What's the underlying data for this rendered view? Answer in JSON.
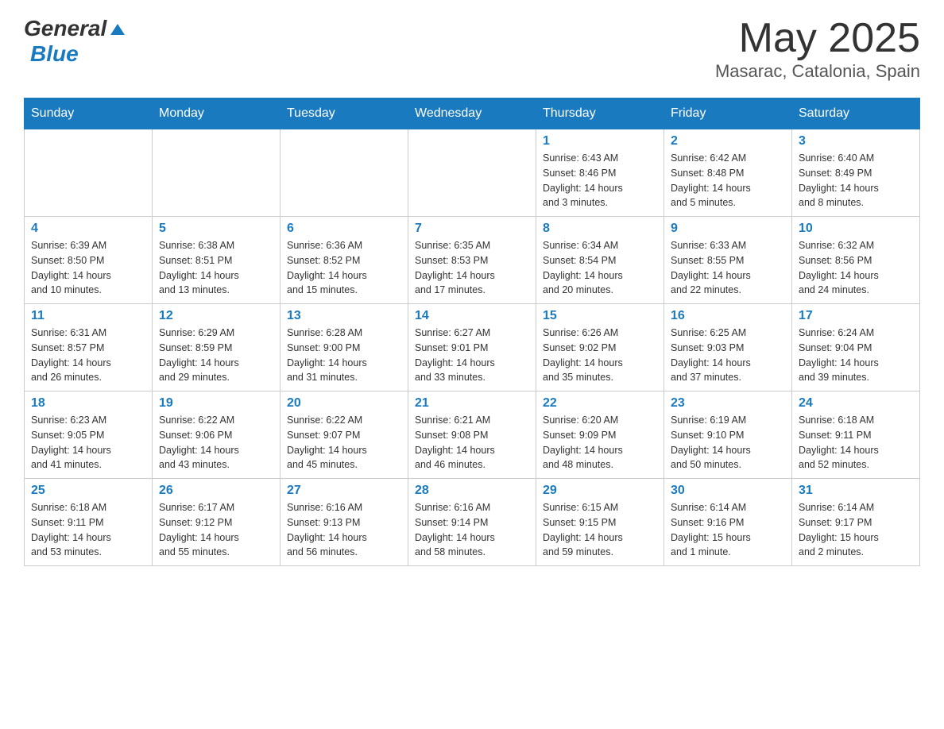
{
  "header": {
    "logo_text_general": "General",
    "logo_text_blue": "Blue",
    "month": "May 2025",
    "location": "Masarac, Catalonia, Spain"
  },
  "days_of_week": [
    "Sunday",
    "Monday",
    "Tuesday",
    "Wednesday",
    "Thursday",
    "Friday",
    "Saturday"
  ],
  "weeks": [
    [
      {
        "day": "",
        "info": ""
      },
      {
        "day": "",
        "info": ""
      },
      {
        "day": "",
        "info": ""
      },
      {
        "day": "",
        "info": ""
      },
      {
        "day": "1",
        "info": "Sunrise: 6:43 AM\nSunset: 8:46 PM\nDaylight: 14 hours\nand 3 minutes."
      },
      {
        "day": "2",
        "info": "Sunrise: 6:42 AM\nSunset: 8:48 PM\nDaylight: 14 hours\nand 5 minutes."
      },
      {
        "day": "3",
        "info": "Sunrise: 6:40 AM\nSunset: 8:49 PM\nDaylight: 14 hours\nand 8 minutes."
      }
    ],
    [
      {
        "day": "4",
        "info": "Sunrise: 6:39 AM\nSunset: 8:50 PM\nDaylight: 14 hours\nand 10 minutes."
      },
      {
        "day": "5",
        "info": "Sunrise: 6:38 AM\nSunset: 8:51 PM\nDaylight: 14 hours\nand 13 minutes."
      },
      {
        "day": "6",
        "info": "Sunrise: 6:36 AM\nSunset: 8:52 PM\nDaylight: 14 hours\nand 15 minutes."
      },
      {
        "day": "7",
        "info": "Sunrise: 6:35 AM\nSunset: 8:53 PM\nDaylight: 14 hours\nand 17 minutes."
      },
      {
        "day": "8",
        "info": "Sunrise: 6:34 AM\nSunset: 8:54 PM\nDaylight: 14 hours\nand 20 minutes."
      },
      {
        "day": "9",
        "info": "Sunrise: 6:33 AM\nSunset: 8:55 PM\nDaylight: 14 hours\nand 22 minutes."
      },
      {
        "day": "10",
        "info": "Sunrise: 6:32 AM\nSunset: 8:56 PM\nDaylight: 14 hours\nand 24 minutes."
      }
    ],
    [
      {
        "day": "11",
        "info": "Sunrise: 6:31 AM\nSunset: 8:57 PM\nDaylight: 14 hours\nand 26 minutes."
      },
      {
        "day": "12",
        "info": "Sunrise: 6:29 AM\nSunset: 8:59 PM\nDaylight: 14 hours\nand 29 minutes."
      },
      {
        "day": "13",
        "info": "Sunrise: 6:28 AM\nSunset: 9:00 PM\nDaylight: 14 hours\nand 31 minutes."
      },
      {
        "day": "14",
        "info": "Sunrise: 6:27 AM\nSunset: 9:01 PM\nDaylight: 14 hours\nand 33 minutes."
      },
      {
        "day": "15",
        "info": "Sunrise: 6:26 AM\nSunset: 9:02 PM\nDaylight: 14 hours\nand 35 minutes."
      },
      {
        "day": "16",
        "info": "Sunrise: 6:25 AM\nSunset: 9:03 PM\nDaylight: 14 hours\nand 37 minutes."
      },
      {
        "day": "17",
        "info": "Sunrise: 6:24 AM\nSunset: 9:04 PM\nDaylight: 14 hours\nand 39 minutes."
      }
    ],
    [
      {
        "day": "18",
        "info": "Sunrise: 6:23 AM\nSunset: 9:05 PM\nDaylight: 14 hours\nand 41 minutes."
      },
      {
        "day": "19",
        "info": "Sunrise: 6:22 AM\nSunset: 9:06 PM\nDaylight: 14 hours\nand 43 minutes."
      },
      {
        "day": "20",
        "info": "Sunrise: 6:22 AM\nSunset: 9:07 PM\nDaylight: 14 hours\nand 45 minutes."
      },
      {
        "day": "21",
        "info": "Sunrise: 6:21 AM\nSunset: 9:08 PM\nDaylight: 14 hours\nand 46 minutes."
      },
      {
        "day": "22",
        "info": "Sunrise: 6:20 AM\nSunset: 9:09 PM\nDaylight: 14 hours\nand 48 minutes."
      },
      {
        "day": "23",
        "info": "Sunrise: 6:19 AM\nSunset: 9:10 PM\nDaylight: 14 hours\nand 50 minutes."
      },
      {
        "day": "24",
        "info": "Sunrise: 6:18 AM\nSunset: 9:11 PM\nDaylight: 14 hours\nand 52 minutes."
      }
    ],
    [
      {
        "day": "25",
        "info": "Sunrise: 6:18 AM\nSunset: 9:11 PM\nDaylight: 14 hours\nand 53 minutes."
      },
      {
        "day": "26",
        "info": "Sunrise: 6:17 AM\nSunset: 9:12 PM\nDaylight: 14 hours\nand 55 minutes."
      },
      {
        "day": "27",
        "info": "Sunrise: 6:16 AM\nSunset: 9:13 PM\nDaylight: 14 hours\nand 56 minutes."
      },
      {
        "day": "28",
        "info": "Sunrise: 6:16 AM\nSunset: 9:14 PM\nDaylight: 14 hours\nand 58 minutes."
      },
      {
        "day": "29",
        "info": "Sunrise: 6:15 AM\nSunset: 9:15 PM\nDaylight: 14 hours\nand 59 minutes."
      },
      {
        "day": "30",
        "info": "Sunrise: 6:14 AM\nSunset: 9:16 PM\nDaylight: 15 hours\nand 1 minute."
      },
      {
        "day": "31",
        "info": "Sunrise: 6:14 AM\nSunset: 9:17 PM\nDaylight: 15 hours\nand 2 minutes."
      }
    ]
  ]
}
